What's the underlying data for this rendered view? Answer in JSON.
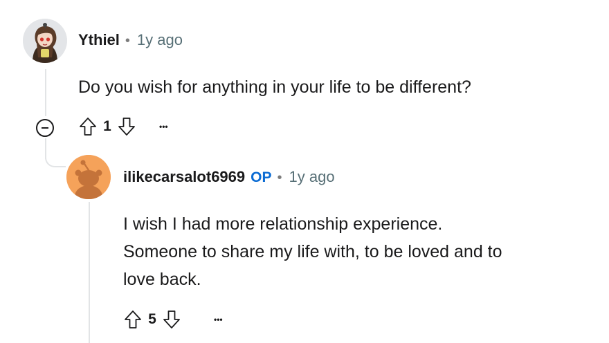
{
  "colors": {
    "op_color": "#0a6bd3",
    "thread_line": "#e2e4e6",
    "meta_gray": "#576f76"
  },
  "comment": {
    "username": "Ythiel",
    "separator": "•",
    "time": "1y ago",
    "body": "Do you wish for anything in your life to be different?",
    "score": "1",
    "more_label": "•••",
    "avatar_icon": "anime-girl-avatar-icon"
  },
  "reply": {
    "username": "ilikecarsalot6969",
    "op_badge": "OP",
    "separator": "•",
    "time": "1y ago",
    "body_lines": [
      "I wish I had more relationship experience.",
      "Someone to share my life with, to be loved and to",
      "love back."
    ],
    "score": "5",
    "more_label": "•••",
    "avatar_icon": "default-snoo-avatar-icon"
  }
}
